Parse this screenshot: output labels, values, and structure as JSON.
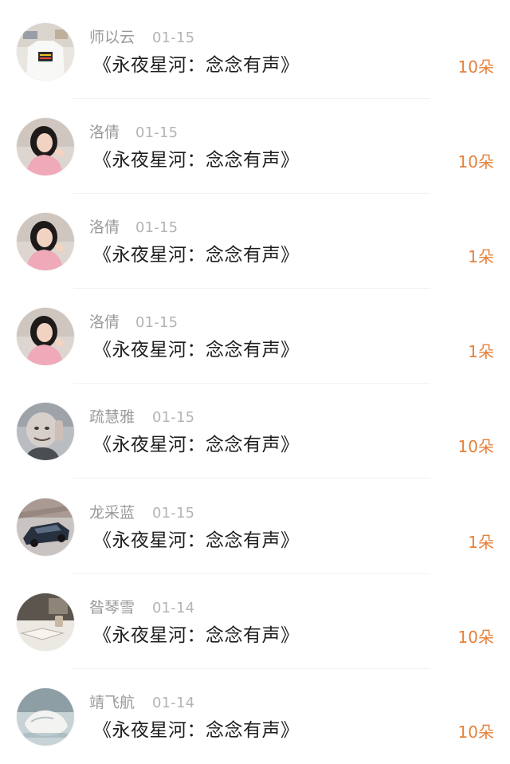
{
  "colors": {
    "accent": "#e5813a",
    "name": "#9a9a9a",
    "date": "#b4b4b4",
    "title": "#1f1f1f"
  },
  "items": [
    {
      "name": "师以云",
      "date": "01-15",
      "title": "《永夜星河：念念有声》",
      "amount": "10朵",
      "avatar": "avatar-1-icon"
    },
    {
      "name": "洛倩",
      "date": "01-15",
      "title": "《永夜星河：念念有声》",
      "amount": "10朵",
      "avatar": "avatar-2-icon"
    },
    {
      "name": "洛倩",
      "date": "01-15",
      "title": "《永夜星河：念念有声》",
      "amount": "1朵",
      "avatar": "avatar-2-icon"
    },
    {
      "name": "洛倩",
      "date": "01-15",
      "title": "《永夜星河：念念有声》",
      "amount": "1朵",
      "avatar": "avatar-2-icon"
    },
    {
      "name": "疏慧雅",
      "date": "01-15",
      "title": "《永夜星河：念念有声》",
      "amount": "10朵",
      "avatar": "avatar-3-icon"
    },
    {
      "name": "龙采蓝",
      "date": "01-15",
      "title": "《永夜星河：念念有声》",
      "amount": "1朵",
      "avatar": "avatar-4-icon"
    },
    {
      "name": "昝琴雪",
      "date": "01-14",
      "title": "《永夜星河：念念有声》",
      "amount": "10朵",
      "avatar": "avatar-5-icon"
    },
    {
      "name": "靖飞航",
      "date": "01-14",
      "title": "《永夜星河：念念有声》",
      "amount": "10朵",
      "avatar": "avatar-6-icon"
    }
  ]
}
